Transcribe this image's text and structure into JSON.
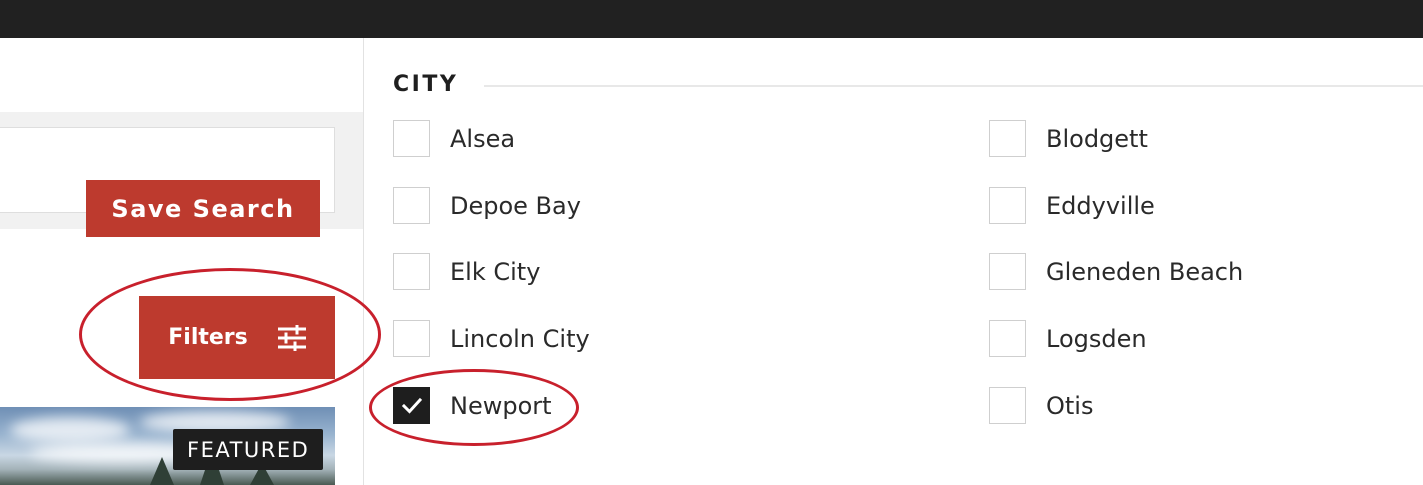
{
  "toolbar": {
    "save_search_label": "Save Search",
    "filters_label": "Filters"
  },
  "listing": {
    "badge": "FEATURED"
  },
  "city_filter": {
    "title": "CITY",
    "options": [
      {
        "label": "Alsea",
        "checked": false
      },
      {
        "label": "Blodgett",
        "checked": false
      },
      {
        "label": "Depoe Bay",
        "checked": false
      },
      {
        "label": "Eddyville",
        "checked": false
      },
      {
        "label": "Elk City",
        "checked": false
      },
      {
        "label": "Gleneden Beach",
        "checked": false
      },
      {
        "label": "Lincoln City",
        "checked": false
      },
      {
        "label": "Logsden",
        "checked": false
      },
      {
        "label": "Newport",
        "checked": true
      },
      {
        "label": "Otis",
        "checked": false
      }
    ]
  },
  "colors": {
    "accent": "#bd3a2e",
    "top_bar": "#212121",
    "annotation": "#c8202c",
    "checkbox_checked": "#1e1e1e"
  },
  "icons": [
    "sliders-icon",
    "checkmark-icon"
  ]
}
